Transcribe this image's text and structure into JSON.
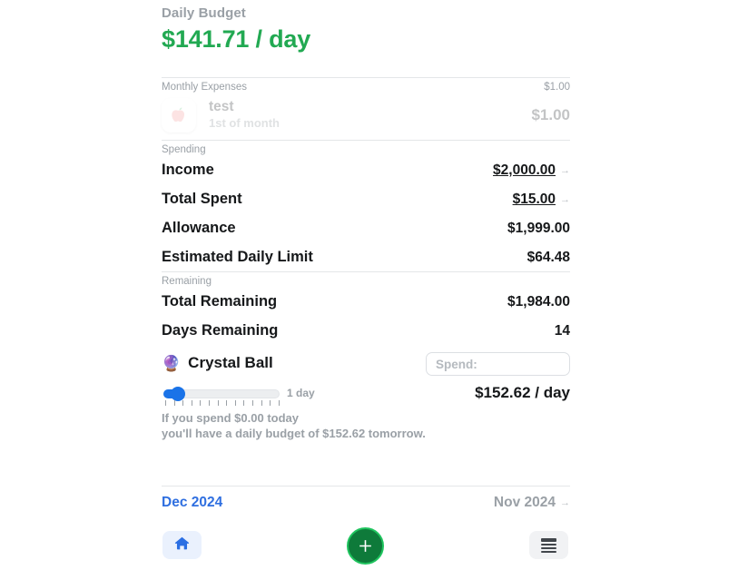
{
  "header": {
    "label": "Daily Budget",
    "amount": "$141.71 / day",
    "accent_color": "#22a952"
  },
  "monthly_expenses": {
    "section_label": "Monthly Expenses",
    "section_total": "$1.00",
    "items": [
      {
        "icon": "apple-icon",
        "name": "test",
        "schedule": "1st of month",
        "amount": "$1.00"
      }
    ]
  },
  "spending": {
    "section_label": "Spending",
    "rows": [
      {
        "label": "Income",
        "value": "$2,000.00",
        "link": true,
        "arrow": "→"
      },
      {
        "label": "Total Spent",
        "value": "$15.00",
        "link": true,
        "arrow": "→"
      },
      {
        "label": "Allowance",
        "value": "$1,999.00",
        "link": false,
        "arrow": ""
      },
      {
        "label": "Estimated Daily Limit",
        "value": "$64.48",
        "link": false,
        "arrow": ""
      }
    ]
  },
  "remaining": {
    "section_label": "Remaining",
    "rows": [
      {
        "label": "Total Remaining",
        "value": "$1,984.00"
      },
      {
        "label": "Days Remaining",
        "value": "14"
      }
    ]
  },
  "crystal_ball": {
    "emoji": "🔮",
    "title": "Crystal Ball",
    "spend_input_value": "",
    "spend_input_placeholder": "Spend:",
    "slider_label": "1 day",
    "slider_value": 1,
    "slider_min": 1,
    "slider_max": 14,
    "slider_ticks": 14,
    "projected_daily": "$152.62 / day",
    "note_line1": "If you spend $0.00 today",
    "note_line2": "you'll have a daily budget of $152.62 tomorrow.",
    "slider_color": "#1a73e8"
  },
  "month_nav": {
    "current": "Dec 2024",
    "previous": "Nov 2024",
    "arrow": "→",
    "current_color": "#2f6fe0"
  },
  "bottom_bar": {
    "home_icon": "home-icon",
    "add_icon": "plus-icon",
    "list_icon": "list-icon",
    "add_color": "#0e7a3a"
  }
}
